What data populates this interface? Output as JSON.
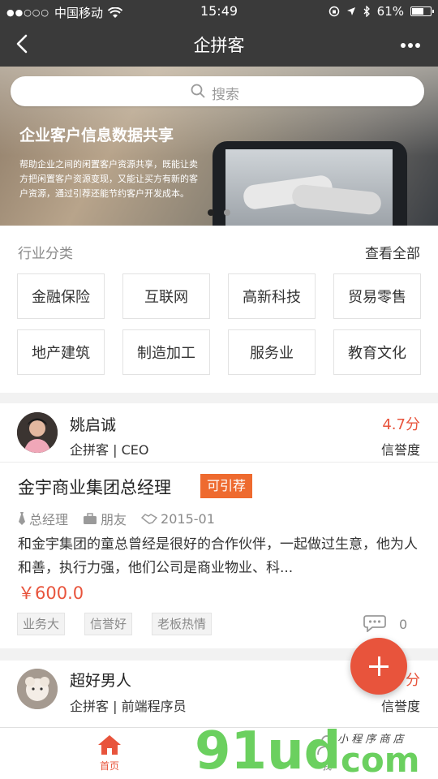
{
  "status_bar": {
    "carrier": "中国移动",
    "time": "15:49",
    "battery": "61%",
    "battery_level": 0.61
  },
  "navbar": {
    "title": "企拼客",
    "back_icon": "chevron-left-icon",
    "more_icon": "more-dots-icon"
  },
  "search": {
    "placeholder": "搜索",
    "icon": "search-icon"
  },
  "banner": {
    "headline": "企业客户信息数据共享",
    "description": "帮助企业之间的闲置客户资源共享，既能让卖方把闲置客户资源变现，又能让买方有新的客户资源，通过引荐还能节约客户开发成本。"
  },
  "categories": {
    "header": "行业分类",
    "view_all": "查看全部",
    "items": [
      "金融保险",
      "互联网",
      "高新科技",
      "贸易零售",
      "地产建筑",
      "制造加工",
      "服务业",
      "教育文化"
    ]
  },
  "cards": [
    {
      "name": "姚启诚",
      "meta": "企拼客 | CEO",
      "score": "4.7分",
      "credit_label": "信誉度",
      "title": "金宇商业集团总经理",
      "badge": "可引荐",
      "position": "总经理",
      "relation": "朋友",
      "since": "2015-01",
      "description": "和金宇集团的童总曾经是很好的合作伙伴，一起做过生意，他为人和善，执行力强，他们公司是商业物业、科...",
      "price": "￥600.0",
      "tags": [
        "业务大",
        "信誉好",
        "老板热情"
      ],
      "comments": "0"
    },
    {
      "name": "超好男人",
      "meta": "企拼客 | 前端程序员",
      "score": "分",
      "credit_label": "信誉度"
    }
  ],
  "fab": {
    "icon": "plus-icon"
  },
  "tabbar": {
    "home_label": "首页",
    "me_label": "我"
  },
  "colors": {
    "accent": "#e8543c",
    "badge": "#ee6a2f",
    "dark_bar": "#3a3a3a"
  }
}
